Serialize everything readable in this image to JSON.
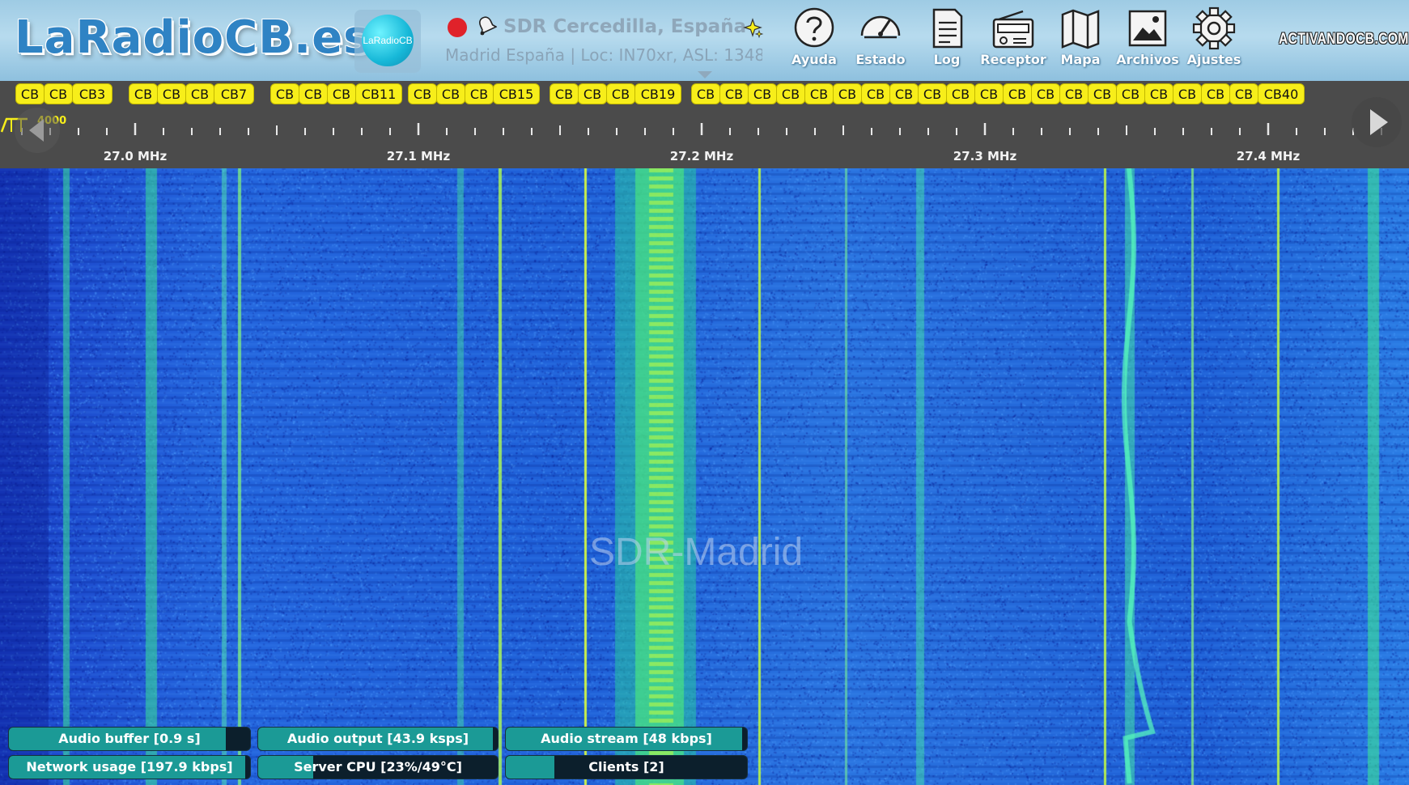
{
  "header": {
    "logo_text": "LaRadioCB.es",
    "avatar_label": "LaRadioCB",
    "title": "SDR Cercedilla, España",
    "subtitle": "Madrid España | Loc: IN70xr, ASL: 1348",
    "partner_logo": "ACTIVANDOCB.COM",
    "nav": [
      {
        "label": "Ayuda",
        "icon": "help-icon"
      },
      {
        "label": "Estado",
        "icon": "gauge-icon"
      },
      {
        "label": "Log",
        "icon": "log-icon"
      },
      {
        "label": "Receptor",
        "icon": "radio-icon"
      },
      {
        "label": "Mapa",
        "icon": "map-icon"
      },
      {
        "label": "Archivos",
        "icon": "image-icon"
      },
      {
        "label": "Ajustes",
        "icon": "gear-icon"
      }
    ]
  },
  "scale": {
    "filter_readout": "4000",
    "ticks": [
      "27.0 MHz",
      "27.1 MHz",
      "27.2 MHz",
      "27.3 MHz",
      "27.4 MHz"
    ],
    "bookmarks": [
      "CB",
      "CB",
      "CB3",
      "CB",
      "CB",
      "CB",
      "CB7",
      "CB",
      "CB",
      "CB",
      "CB11",
      "CB",
      "CB",
      "CB",
      "CB15",
      "CB",
      "CB",
      "CB",
      "CB19",
      "CB",
      "CB",
      "CB",
      "CB",
      "CB",
      "CB",
      "CB",
      "CB",
      "CB",
      "CB",
      "CB",
      "CB",
      "CB",
      "CB",
      "CB",
      "CB",
      "CB",
      "CB",
      "CB",
      "CB",
      "CB40"
    ]
  },
  "waterfall": {
    "watermark": "SDR-Madrid"
  },
  "status": {
    "audio_buffer": "Audio buffer [0.9 s]",
    "audio_output": "Audio output [43.9 ksps]",
    "audio_stream": "Audio stream [48 kbps]",
    "network_usage": "Network usage [197.9 kbps]",
    "server_cpu": "Server CPU [23%/49°C]",
    "clients": "Clients [2]",
    "levels": {
      "audio_buffer": 0.9,
      "audio_output": 0.98,
      "audio_stream": 0.98,
      "network_usage": 0.98,
      "server_cpu": 0.23,
      "clients": 0.2
    }
  },
  "colors": {
    "bookmark": "#f7ee1a",
    "status_fill": "#1b9a96",
    "waterfall_base": "#1f5fd6",
    "signal": "#37e08a"
  }
}
